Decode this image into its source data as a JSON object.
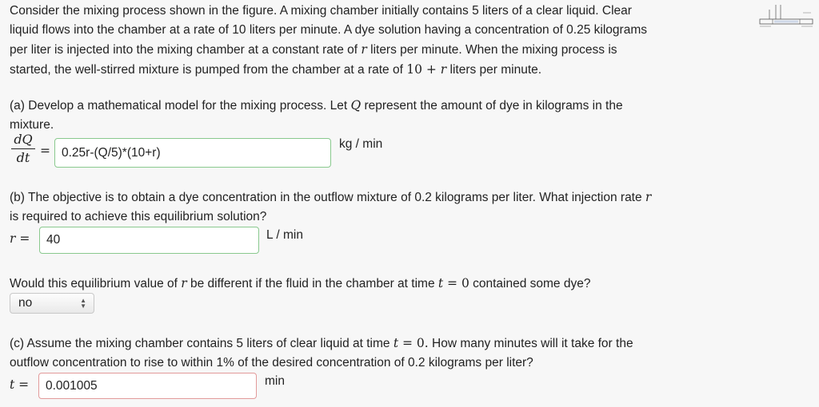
{
  "intro": {
    "line1": "Consider the mixing process shown in the figure. A mixing chamber initially contains 5 liters of a clear liquid. Clear",
    "line2": "liquid flows into the chamber at a rate of 10 liters per minute. A dye solution having a concentration of 0.25 kilograms",
    "line3_pre": "per liter is injected into the mixing chamber at a constant rate of ",
    "line3_var": "r",
    "line3_post": " liters per minute. When the mixing process is",
    "line4_pre": "started, the well-stirred mixture is pumped from the chamber at a rate of ",
    "line4_math1": "10 + ",
    "line4_var": "r",
    "line4_post": " liters per minute."
  },
  "part_a": {
    "line1_pre": "(a) Develop a mathematical model for the mixing process. Let ",
    "line1_var": "Q",
    "line1_post": " represent the amount of dye in kilograms in the",
    "line2": "mixture.",
    "frac_num": "dQ",
    "frac_den": "dt",
    "equals": "=",
    "answer": "0.25r-(Q/5)*(10+r)",
    "unit": "kg / min"
  },
  "part_b": {
    "line1_pre": "(b) The objective is to obtain a dye concentration in the outflow mixture of 0.2 kilograms per liter. What injection rate ",
    "line1_var": "r",
    "line2": "is required to achieve this equilibrium solution?",
    "label_var": "r",
    "label_eq": " =",
    "answer": "40",
    "unit": "L / min",
    "follow_pre": "Would this equilibrium value of ",
    "follow_var": "r",
    "follow_mid": " be different if the fluid in the chamber at time ",
    "follow_var2": "t",
    "follow_eq": " = 0",
    "follow_post": " contained some dye?",
    "select_value": "no"
  },
  "part_c": {
    "line1_pre": "(c) Assume the mixing chamber contains 5 liters of clear liquid at time ",
    "line1_var": "t",
    "line1_eq": " = 0.",
    "line1_post": " How many minutes will it take for the",
    "line2": "outflow concentration to rise to within 1% of the desired concentration of 0.2 kilograms per liter?",
    "label_var": "t",
    "label_eq": " =",
    "answer": "0.001005",
    "unit": "min"
  }
}
